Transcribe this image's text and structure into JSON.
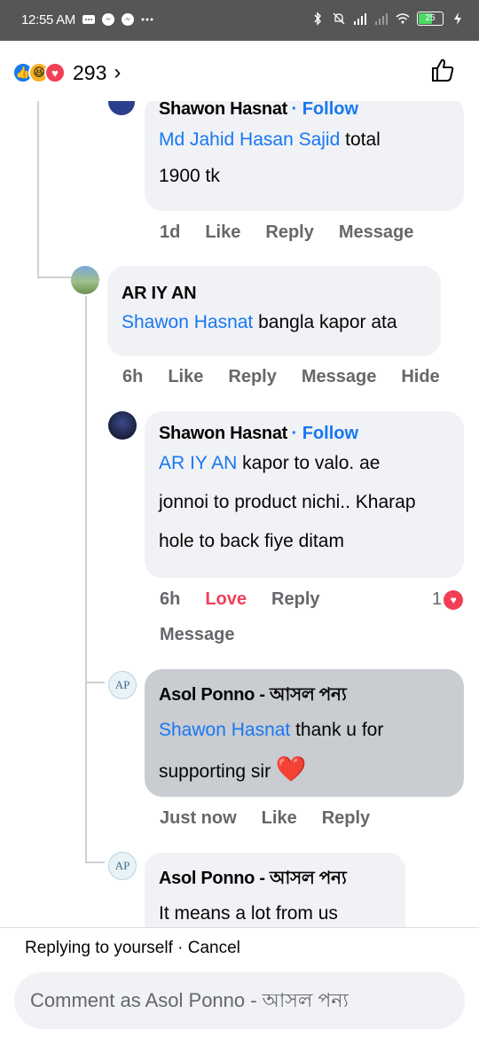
{
  "status": {
    "time": "12:55 AM",
    "battery": "25"
  },
  "header": {
    "reaction_count": "293",
    "chevron": "›"
  },
  "colors": {
    "accent": "#1877f2",
    "love": "#f33e58",
    "bubble": "#f0f2f5",
    "bubble_selected": "#c9ccd1",
    "muted": "#65676b"
  },
  "comments": [
    {
      "author": "Shawon Hasnat",
      "follow": "· Follow",
      "mention": "Md Jahid Hasan Sajid",
      "text_line1": " total",
      "text_line2": "1900 tk",
      "time": "1d",
      "like": "Like",
      "reply": "Reply",
      "message": "Message"
    },
    {
      "author": "AR IY AN",
      "mention": "Shawon Hasnat",
      "text": " bangla kapor ata",
      "time": "6h",
      "like": "Like",
      "reply": "Reply",
      "message": "Message",
      "hide": "Hide"
    },
    {
      "author": "Shawon Hasnat",
      "follow": "· Follow",
      "mention": "AR IY AN",
      "text_line1": " kapor to valo.   ae",
      "text_line2": "jonnoi to product nichi..  Kharap",
      "text_line3": "hole to back fiye ditam",
      "time": "6h",
      "love": "Love",
      "reply": "Reply",
      "message": "Message",
      "react_count": "1"
    },
    {
      "author": "Asol Ponno - আসল পন্য",
      "mention": "Shawon Hasnat",
      "text_line1": " thank u for",
      "text_line2": "supporting sir ",
      "emoji": "❤️",
      "time": "Just now",
      "like": "Like",
      "reply": "Reply"
    },
    {
      "author": "Asol Ponno - আসল পন্য",
      "text": "It means a lot from us"
    }
  ],
  "footer": {
    "replying": "Replying to yourself · ",
    "cancel": "Cancel",
    "placeholder": "Comment as Asol Ponno - আসল পন্য"
  }
}
